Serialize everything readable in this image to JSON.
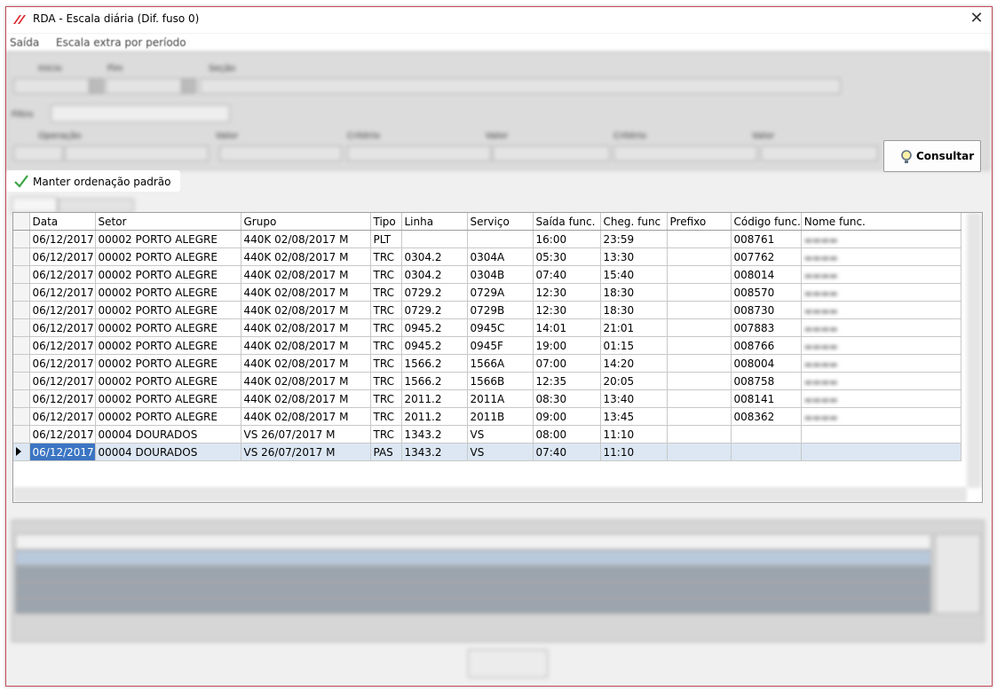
{
  "window": {
    "title": "RDA - Escala diária (Dif. fuso 0)",
    "close_glyph": "✕",
    "accent_color": "#c64b58"
  },
  "menu": {
    "items": [
      "Saída",
      "Escala extra por período"
    ]
  },
  "toolbar": {
    "consult_label": "Consultar",
    "consult_icon": "search-icon"
  },
  "options": {
    "manter_label": "Manter ordenação padrão",
    "manter_checked": true
  },
  "grid": {
    "columns": [
      "",
      "Data",
      "Setor",
      "Grupo",
      "Tipo",
      "Linha",
      "Serviço",
      "Saída func.",
      "Cheg. func",
      "Prefixo",
      "Código func.",
      "Nome func."
    ],
    "rows": [
      {
        "data": "06/12/2017",
        "setor": "00002 PORTO ALEGRE",
        "grupo": "440K 02/08/2017 M",
        "tipo": "PLT",
        "linha": "",
        "servico": "",
        "saida": "16:00",
        "cheg": "23:59",
        "prefixo": "",
        "codigo": "008761"
      },
      {
        "data": "06/12/2017",
        "setor": "00002 PORTO ALEGRE",
        "grupo": "440K 02/08/2017 M",
        "tipo": "TRC",
        "linha": "0304.2",
        "servico": "0304A",
        "saida": "05:30",
        "cheg": "13:30",
        "prefixo": "",
        "codigo": "007762"
      },
      {
        "data": "06/12/2017",
        "setor": "00002 PORTO ALEGRE",
        "grupo": "440K 02/08/2017 M",
        "tipo": "TRC",
        "linha": "0304.2",
        "servico": "0304B",
        "saida": "07:40",
        "cheg": "15:40",
        "prefixo": "",
        "codigo": "008014"
      },
      {
        "data": "06/12/2017",
        "setor": "00002 PORTO ALEGRE",
        "grupo": "440K 02/08/2017 M",
        "tipo": "TRC",
        "linha": "0729.2",
        "servico": "0729A",
        "saida": "12:30",
        "cheg": "18:30",
        "prefixo": "",
        "codigo": "008570"
      },
      {
        "data": "06/12/2017",
        "setor": "00002 PORTO ALEGRE",
        "grupo": "440K 02/08/2017 M",
        "tipo": "TRC",
        "linha": "0729.2",
        "servico": "0729B",
        "saida": "12:30",
        "cheg": "18:30",
        "prefixo": "",
        "codigo": "008730"
      },
      {
        "data": "06/12/2017",
        "setor": "00002 PORTO ALEGRE",
        "grupo": "440K 02/08/2017 M",
        "tipo": "TRC",
        "linha": "0945.2",
        "servico": "0945C",
        "saida": "14:01",
        "cheg": "21:01",
        "prefixo": "",
        "codigo": "007883"
      },
      {
        "data": "06/12/2017",
        "setor": "00002 PORTO ALEGRE",
        "grupo": "440K 02/08/2017 M",
        "tipo": "TRC",
        "linha": "0945.2",
        "servico": "0945F",
        "saida": "19:00",
        "cheg": "01:15",
        "prefixo": "",
        "codigo": "008766"
      },
      {
        "data": "06/12/2017",
        "setor": "00002 PORTO ALEGRE",
        "grupo": "440K 02/08/2017 M",
        "tipo": "TRC",
        "linha": "1566.2",
        "servico": "1566A",
        "saida": "07:00",
        "cheg": "14:20",
        "prefixo": "",
        "codigo": "008004"
      },
      {
        "data": "06/12/2017",
        "setor": "00002 PORTO ALEGRE",
        "grupo": "440K 02/08/2017 M",
        "tipo": "TRC",
        "linha": "1566.2",
        "servico": "1566B",
        "saida": "12:35",
        "cheg": "20:05",
        "prefixo": "",
        "codigo": "008758"
      },
      {
        "data": "06/12/2017",
        "setor": "00002 PORTO ALEGRE",
        "grupo": "440K 02/08/2017 M",
        "tipo": "TRC",
        "linha": "2011.2",
        "servico": "2011A",
        "saida": "08:30",
        "cheg": "13:40",
        "prefixo": "",
        "codigo": "008141"
      },
      {
        "data": "06/12/2017",
        "setor": "00002 PORTO ALEGRE",
        "grupo": "440K 02/08/2017 M",
        "tipo": "TRC",
        "linha": "2011.2",
        "servico": "2011B",
        "saida": "09:00",
        "cheg": "13:45",
        "prefixo": "",
        "codigo": "008362"
      },
      {
        "data": "06/12/2017",
        "setor": "00004 DOURADOS",
        "grupo": "VS 26/07/2017 M",
        "tipo": "TRC",
        "linha": "1343.2",
        "servico": "VS",
        "saida": "08:00",
        "cheg": "11:10",
        "prefixo": "",
        "codigo": ""
      },
      {
        "data": "06/12/2017",
        "setor": "00004 DOURADOS",
        "grupo": "VS 26/07/2017 M",
        "tipo": "PAS",
        "linha": "1343.2",
        "servico": "VS",
        "saida": "07:40",
        "cheg": "11:10",
        "prefixo": "",
        "codigo": ""
      }
    ],
    "selected_row": 12,
    "selection_color": "#3b75c3"
  }
}
